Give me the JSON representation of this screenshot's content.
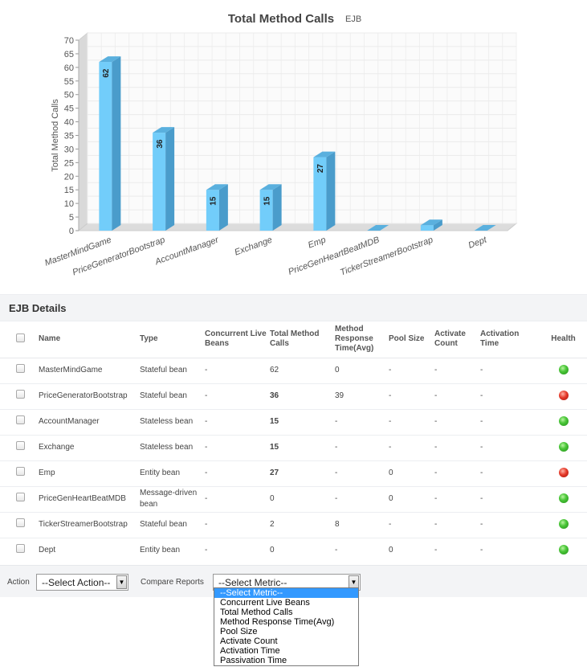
{
  "chart_data": {
    "type": "bar",
    "title": "Total Method Calls",
    "subtitle": "EJB",
    "ylabel": "Total Method Calls",
    "xlabel": "",
    "ylim": [
      0,
      70
    ],
    "yticks": [
      0,
      5,
      10,
      15,
      20,
      25,
      30,
      35,
      40,
      45,
      50,
      55,
      60,
      65,
      70
    ],
    "categories": [
      "MasterMindGame",
      "PriceGeneratorBootstrap",
      "AccountManager",
      "Exchange",
      "Emp",
      "PriceGenHeartBeatMDB",
      "TickerStreamerBootstrap",
      "Dept"
    ],
    "values": [
      62,
      36,
      15,
      15,
      27,
      0,
      2,
      0
    ],
    "data_labels": [
      "62",
      "36",
      "15",
      "15",
      "27",
      "",
      "",
      ""
    ],
    "grid": true,
    "bar_color": "#6cc8f7"
  },
  "section": {
    "title": "EJB Details"
  },
  "table": {
    "headers": {
      "name": "Name",
      "type": "Type",
      "concurrent": "Concurrent Live Beans",
      "total_calls": "Total Method Calls",
      "response": "Method Response Time(Avg)",
      "pool": "Pool Size",
      "activate": "Activate Count",
      "activation_time": "Activation Time",
      "health": "Health"
    },
    "rows": [
      {
        "name": "MasterMindGame",
        "type": "Stateful bean",
        "concurrent": "-",
        "total_calls": "62",
        "response": "0",
        "pool": "-",
        "activate": "-",
        "activation_time": "-",
        "health": "green"
      },
      {
        "name": "PriceGeneratorBootstrap",
        "type": "Stateful bean",
        "concurrent": "-",
        "total_calls": "36",
        "response": "39",
        "pool": "-",
        "activate": "-",
        "activation_time": "-",
        "health": "red"
      },
      {
        "name": "AccountManager",
        "type": "Stateless bean",
        "concurrent": "-",
        "total_calls": "15",
        "response": "-",
        "pool": "-",
        "activate": "-",
        "activation_time": "-",
        "health": "green"
      },
      {
        "name": "Exchange",
        "type": "Stateless bean",
        "concurrent": "-",
        "total_calls": "15",
        "response": "-",
        "pool": "-",
        "activate": "-",
        "activation_time": "-",
        "health": "green"
      },
      {
        "name": "Emp",
        "type": "Entity bean",
        "concurrent": "-",
        "total_calls": "27",
        "response": "-",
        "pool": "0",
        "activate": "-",
        "activation_time": "-",
        "health": "red"
      },
      {
        "name": "PriceGenHeartBeatMDB",
        "type": "Message-driven bean",
        "concurrent": "-",
        "total_calls": "0",
        "response": "-",
        "pool": "0",
        "activate": "-",
        "activation_time": "-",
        "health": "green"
      },
      {
        "name": "TickerStreamerBootstrap",
        "type": "Stateful bean",
        "concurrent": "-",
        "total_calls": "2",
        "response": "8",
        "pool": "-",
        "activate": "-",
        "activation_time": "-",
        "health": "green"
      },
      {
        "name": "Dept",
        "type": "Entity bean",
        "concurrent": "-",
        "total_calls": "0",
        "response": "-",
        "pool": "0",
        "activate": "-",
        "activation_time": "-",
        "health": "green"
      }
    ]
  },
  "footer": {
    "action_label": "Action",
    "action_select": "--Select Action--",
    "compare_label": "Compare Reports",
    "metric_select": "--Select Metric--",
    "metric_options": [
      "--Select Metric--",
      "Concurrent Live Beans",
      "Total Method Calls",
      "Method Response Time(Avg)",
      "Pool Size",
      "Activate Count",
      "Activation Time",
      "Passivation Time"
    ]
  },
  "colors": {
    "healthy": "#3cb82e",
    "critical": "#d9281a",
    "bar": "#6cc8f7"
  }
}
